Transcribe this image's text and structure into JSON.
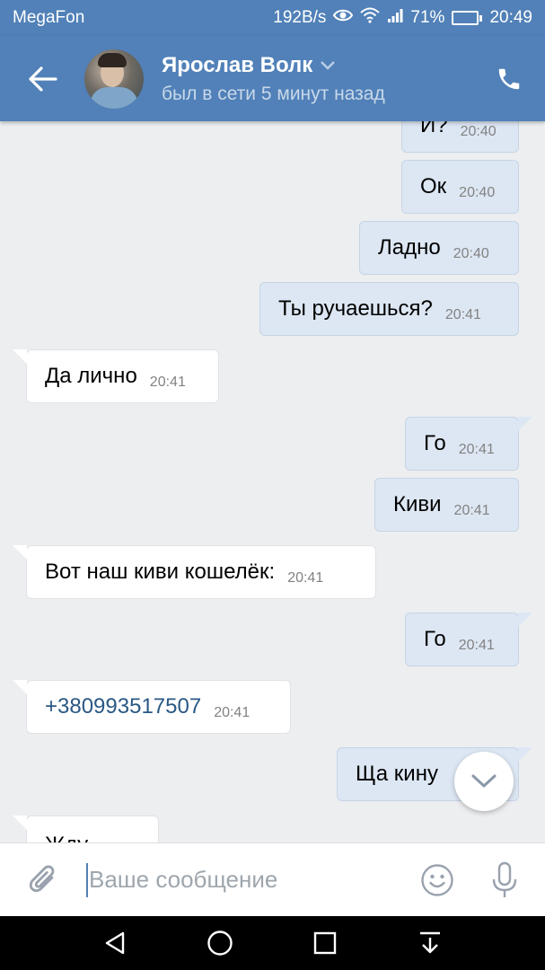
{
  "status_bar": {
    "carrier": "MegaFon",
    "net_speed": "192B/s",
    "battery": "71%",
    "battery_level": 0.71,
    "time": "20:49"
  },
  "header": {
    "name": "Ярослав Волк",
    "status": "был в сети 5 минут назад",
    "back_icon": "arrow-left-icon",
    "call_icon": "phone-icon",
    "expand_icon": "chevron-down-icon"
  },
  "messages": [
    {
      "dir": "out",
      "text": "И?",
      "time": "20:40"
    },
    {
      "dir": "out",
      "text": "Ок",
      "time": "20:40"
    },
    {
      "dir": "out",
      "text": "Ладно",
      "time": "20:40"
    },
    {
      "dir": "out",
      "text": "Ты ручаешься?",
      "time": "20:41"
    },
    {
      "dir": "in",
      "text": "Да лично",
      "time": "20:41"
    },
    {
      "dir": "out",
      "text": "Го",
      "time": "20:41"
    },
    {
      "dir": "out",
      "text": "Киви",
      "time": "20:41"
    },
    {
      "dir": "in",
      "text": "Вот наш киви кошелёк:",
      "time": "20:41"
    },
    {
      "dir": "out",
      "text": "Го",
      "time": "20:41"
    },
    {
      "dir": "in",
      "text": "+380993517507",
      "time": "20:41"
    },
    {
      "dir": "out",
      "text": "Ща кину",
      "time": ""
    },
    {
      "dir": "in",
      "text": "Жду",
      "time": ""
    }
  ],
  "input": {
    "placeholder": "Ваше сообщение",
    "attach_icon": "paperclip-icon",
    "emoji_icon": "smiley-icon",
    "mic_icon": "microphone-icon"
  },
  "colors": {
    "header": "#5181b8",
    "outgoing_bubble": "#dde7f3",
    "incoming_bubble": "#ffffff",
    "background": "#edeef0",
    "link": "#2a5885"
  }
}
